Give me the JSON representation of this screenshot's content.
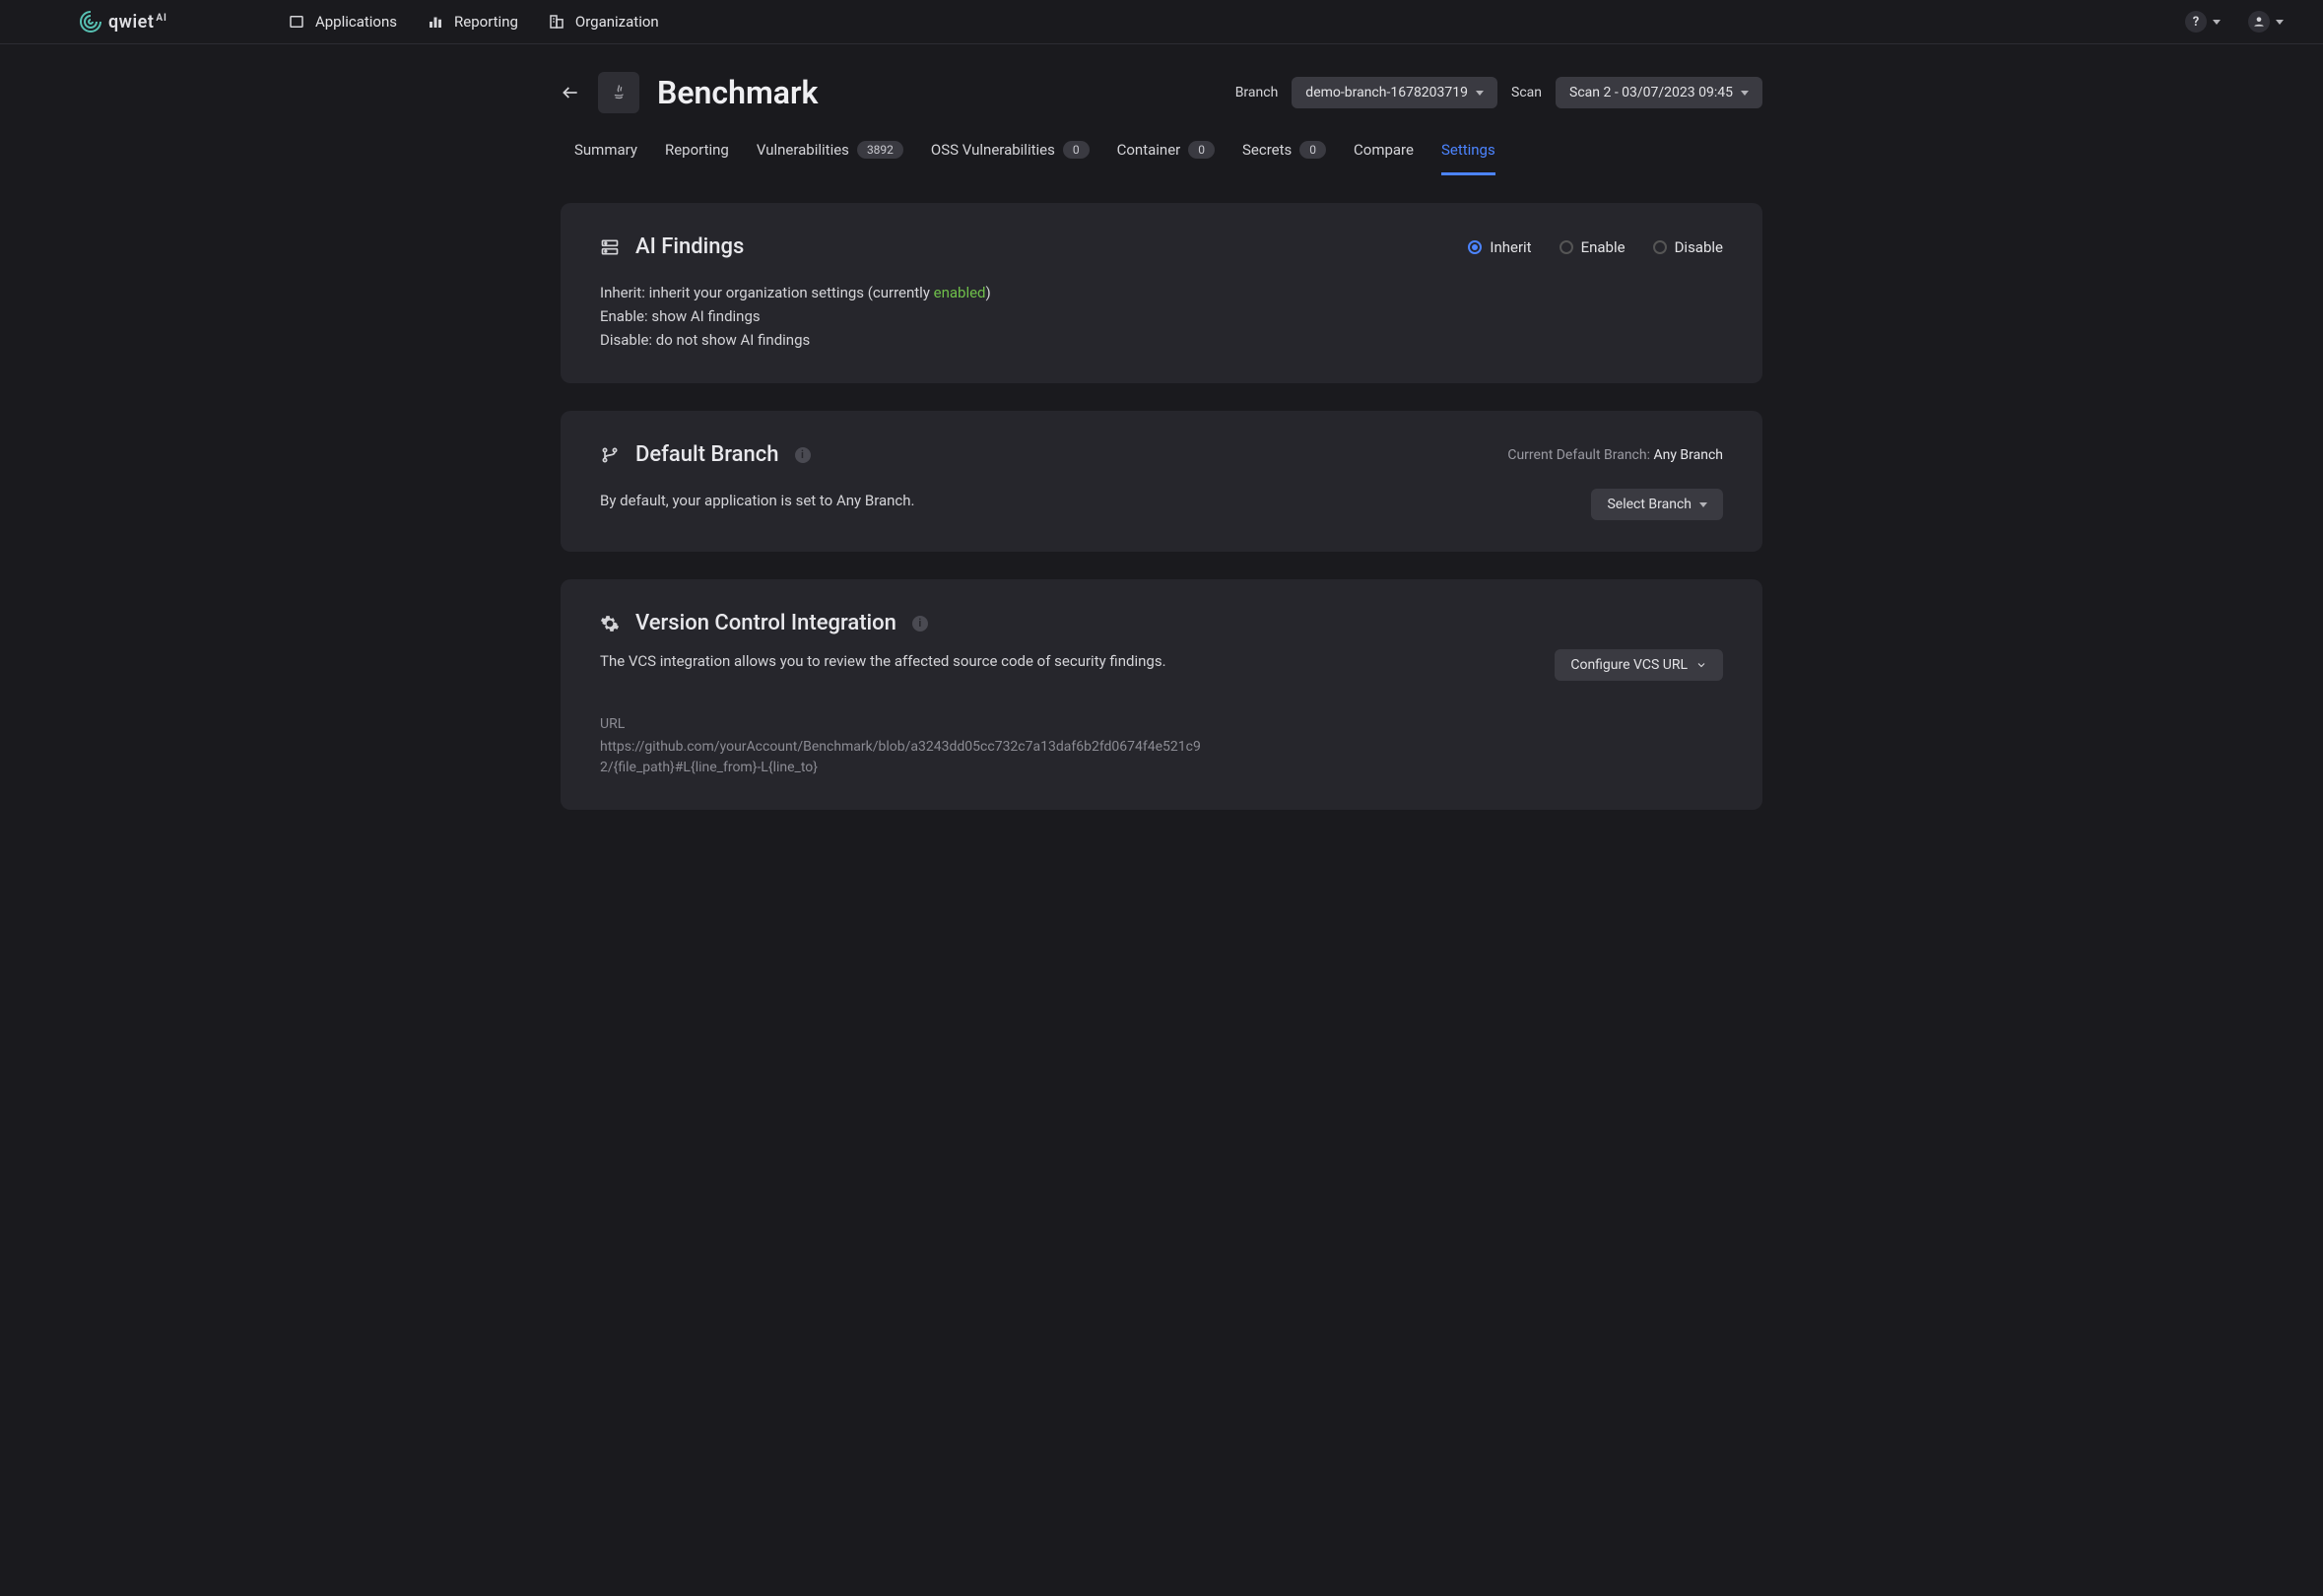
{
  "nav": {
    "brand": "qwiet",
    "brand_suffix": "AI",
    "items": [
      {
        "label": "Applications"
      },
      {
        "label": "Reporting"
      },
      {
        "label": "Organization"
      }
    ]
  },
  "header": {
    "title": "Benchmark",
    "branch_label": "Branch",
    "branch_value": "demo-branch-1678203719",
    "scan_label": "Scan",
    "scan_value": "Scan 2 - 03/07/2023 09:45"
  },
  "tabs": [
    {
      "label": "Summary",
      "badge": null
    },
    {
      "label": "Reporting",
      "badge": null
    },
    {
      "label": "Vulnerabilities",
      "badge": "3892"
    },
    {
      "label": "OSS Vulnerabilities",
      "badge": "0"
    },
    {
      "label": "Container",
      "badge": "0"
    },
    {
      "label": "Secrets",
      "badge": "0"
    },
    {
      "label": "Compare",
      "badge": null
    },
    {
      "label": "Settings",
      "badge": null,
      "active": true
    }
  ],
  "ai_findings": {
    "title": "AI Findings",
    "radios": {
      "inherit": "Inherit",
      "enable": "Enable",
      "disable": "Disable"
    },
    "selected": "inherit",
    "line1_prefix": "Inherit: inherit your organization settings (currently ",
    "line1_status": "enabled",
    "line1_suffix": ")",
    "line2": "Enable: show AI findings",
    "line3": "Disable: do not show AI findings"
  },
  "default_branch": {
    "title": "Default Branch",
    "current_label": "Current Default Branch: ",
    "current_value": "Any Branch",
    "body": "By default, your application is set to Any Branch.",
    "button": "Select Branch"
  },
  "vcs": {
    "title": "Version Control Integration",
    "body": "The VCS integration allows you to review the affected source code of security findings.",
    "button": "Configure VCS URL",
    "url_label": "URL",
    "url_value": "https://github.com/yourAccount/Benchmark/blob/a3243dd05cc732c7a13daf6b2fd0674f4e521c92/{file_path}#L{line_from}-L{line_to}"
  }
}
